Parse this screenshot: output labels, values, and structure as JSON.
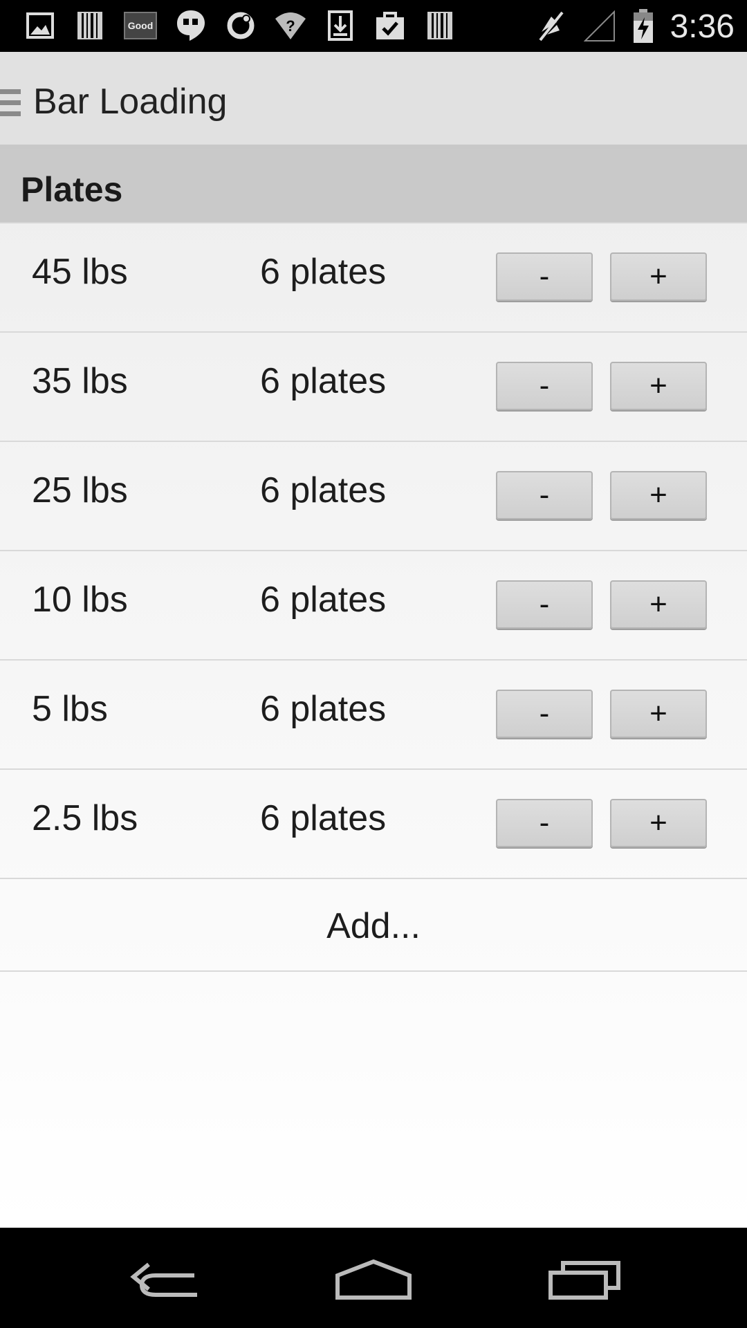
{
  "status_bar": {
    "time": "3:36",
    "notification_icons": [
      "image-icon",
      "barcode-icon",
      "good-icon",
      "hangouts-icon",
      "sync-icon",
      "wifi-question-icon",
      "download-icon",
      "shopping-bag-icon",
      "barcode-icon"
    ],
    "good_label": "Good",
    "system_icons": [
      "mute-icon",
      "no-signal-icon",
      "battery-charging-icon"
    ]
  },
  "action_bar": {
    "title": "Bar Loading",
    "menu_icon": "drawer-menu-icon"
  },
  "plates": {
    "section_title": "Plates",
    "minus_label": "-",
    "plus_label": "+",
    "rows": [
      {
        "weight": "45 lbs",
        "count": "6 plates"
      },
      {
        "weight": "35 lbs",
        "count": "6 plates"
      },
      {
        "weight": "25 lbs",
        "count": "6 plates"
      },
      {
        "weight": "10 lbs",
        "count": "6 plates"
      },
      {
        "weight": "5 lbs",
        "count": "6 plates"
      },
      {
        "weight": "2.5 lbs",
        "count": "6 plates"
      }
    ],
    "add_label": "Add..."
  },
  "nav_bar": {
    "icons": [
      "back-icon",
      "home-icon",
      "recents-icon"
    ]
  }
}
